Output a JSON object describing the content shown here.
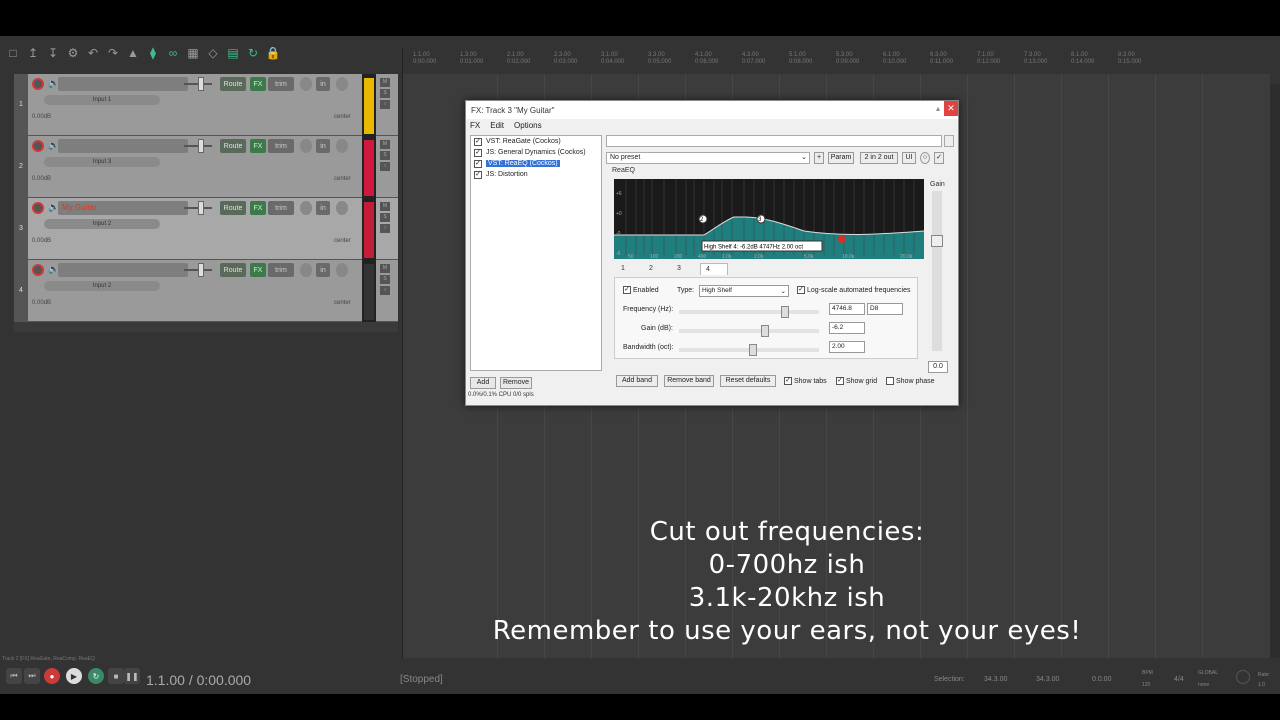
{
  "fx_window": {
    "title": "FX: Track 3 \"My Guitar\"",
    "menu": [
      "FX",
      "Edit",
      "Options"
    ],
    "chain": [
      {
        "label": "VST: ReaGate (Cockos)",
        "checked": true
      },
      {
        "label": "JS: General Dynamics (Cockos)",
        "checked": true
      },
      {
        "label": "VST: ReaEQ (Cockos)",
        "checked": true,
        "selected": true
      },
      {
        "label": "JS: Distortion",
        "checked": true
      }
    ],
    "add_label": "Add",
    "remove_label": "Remove",
    "cpu": "0.0%/0.1% CPU 0/0 spls",
    "preset": "No preset",
    "plus_label": "+",
    "param_label": "Param",
    "io_label": "2 in 2 out",
    "ui_label": "UI",
    "plugin_name": "ReaEQ",
    "graph_y_labels": [
      "+6",
      "+0",
      "-0",
      "-6"
    ],
    "graph_x_labels": [
      "50",
      "100",
      "200",
      "400",
      "1.0k",
      "2.0k",
      "5.0k",
      "10.0k",
      "20.0k"
    ],
    "graph_tooltip": "High Shelf 4: -6.2dB 4747Hz 2.00 oct",
    "node_labels": [
      "2",
      "3"
    ],
    "gain_label": "Gain",
    "gain_value": "0.0",
    "band_tabs": [
      "1",
      "2",
      "3",
      "4"
    ],
    "enabled_label": "Enabled",
    "type_label": "Type:",
    "type_value": "High Shelf",
    "logscale_label": "Log-scale automated frequencies",
    "frequency_label": "Frequency (Hz):",
    "frequency_value": "4746.8",
    "note_value": "D8",
    "gain_db_label": "Gain (dB):",
    "gain_db_value": "-6.2",
    "bandwidth_label": "Bandwidth (oct):",
    "bandwidth_value": "2.00",
    "add_band": "Add band",
    "remove_band": "Remove band",
    "reset_defaults": "Reset defaults",
    "show_tabs": "Show tabs",
    "show_grid": "Show grid",
    "show_phase": "Show phase"
  },
  "tracks": [
    {
      "num": "1",
      "name": "",
      "input": "Input 1",
      "vol": "0.00dB",
      "pan": "center",
      "route": "Route",
      "fx": "FX",
      "trim": "trim",
      "in": "in",
      "meter_color": "#e9b800"
    },
    {
      "num": "2",
      "name": "",
      "input": "Input 3",
      "vol": "0.00dB",
      "pan": "center",
      "route": "Route",
      "fx": "FX",
      "trim": "trim",
      "in": "in",
      "meter_color": "#d0193f"
    },
    {
      "num": "3",
      "name": "My Guitar",
      "input": "Input 2",
      "vol": "0.00dB",
      "pan": "center",
      "route": "Route",
      "fx": "FX",
      "trim": "trim",
      "in": "in",
      "meter_color": "#c41d3a"
    },
    {
      "num": "4",
      "name": "",
      "input": "Input 2",
      "vol": "0.00dB",
      "pan": "center",
      "route": "Route",
      "fx": "FX",
      "trim": "trim",
      "in": "in",
      "meter_color": "#333333"
    }
  ],
  "ruler": {
    "bars": [
      "1.1.00",
      "1.3.00",
      "2.1.00",
      "2.3.00",
      "3.1.00",
      "3.3.00",
      "4.1.00",
      "4.3.00",
      "5.1.00",
      "5.3.00",
      "6.1.00",
      "6.3.00",
      "7.1.00",
      "7.3.00",
      "8.1.00",
      "8.3.00"
    ],
    "times": [
      "0:00.000",
      "0:01.000",
      "0:02.000",
      "0:03.000",
      "0:04.000",
      "0:05.000",
      "0:06.000",
      "0:07.000",
      "0:08.000",
      "0:09.000",
      "0:10.000",
      "0:11.000",
      "0:12.000",
      "0:13.000",
      "0:14.000",
      "0:15.000"
    ]
  },
  "overlay_lines": [
    "Cut out frequencies:",
    "0-700hz ish",
    "3.1k-20khz ish",
    "Remember to use your ears, not your eyes!"
  ],
  "transport": {
    "status_bar": "Track 2 [FX] ReaGate, ReaComp, ReaEQ",
    "time": "1.1.00 / 0:00.000",
    "state": "[Stopped]",
    "selection_label": "Selection:",
    "sel_start": "34.3.00",
    "sel_end": "34.3.00",
    "sel_len": "0.0.00",
    "bpm_label": "BPM",
    "bpm": "120",
    "sig": "4/4",
    "global_label": "GLOBAL",
    "global_value": "none",
    "rate_label": "Rate:",
    "rate_value": "1.0"
  },
  "colors": {
    "accent_green": "#3ac08a",
    "eq_bg": "#1f7f7f",
    "record_red": "#cc3a3a"
  },
  "icons": [
    "new-project-icon",
    "open-icon",
    "save-icon",
    "settings-icon",
    "undo-icon",
    "redo-icon",
    "metronome-icon",
    "snap-icon",
    "ripple-icon",
    "grid-icon",
    "lock-icon"
  ]
}
